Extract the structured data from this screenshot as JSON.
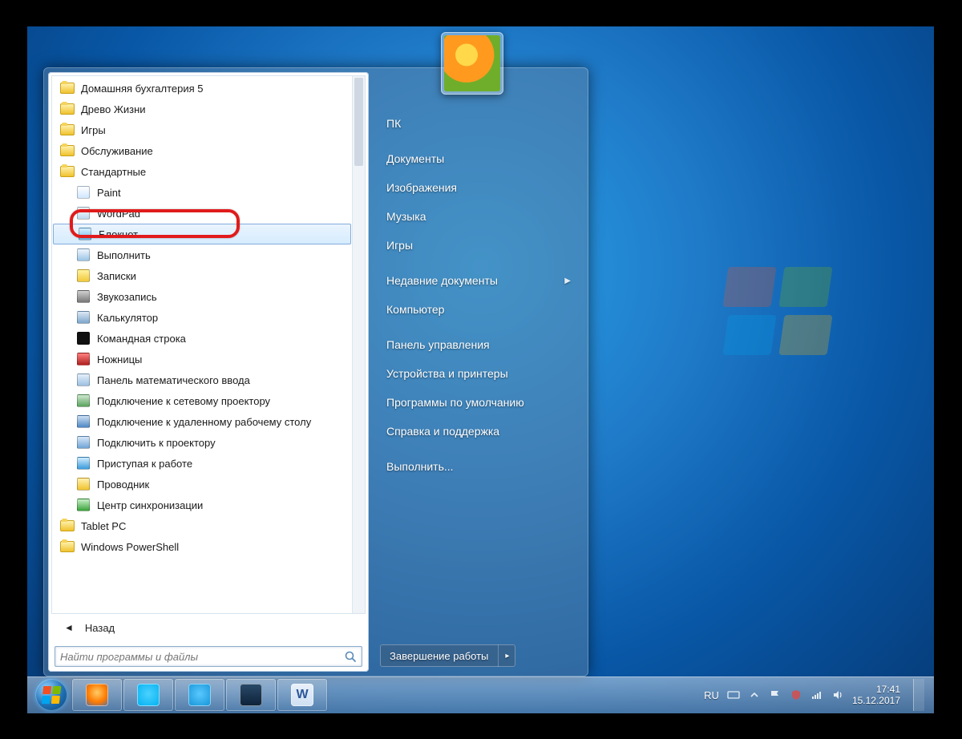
{
  "start_menu": {
    "programs": [
      {
        "label": "Домашняя бухгалтерия 5",
        "type": "folder"
      },
      {
        "label": "Древо Жизни",
        "type": "folder"
      },
      {
        "label": "Игры",
        "type": "folder"
      },
      {
        "label": "Обслуживание",
        "type": "folder"
      },
      {
        "label": "Стандартные",
        "type": "folder"
      },
      {
        "label": "Paint",
        "type": "app",
        "icon_bg": "linear-gradient(#fff,#cfe7ff)"
      },
      {
        "label": "WordPad",
        "type": "app",
        "icon_bg": "linear-gradient(#fff,#bcd8f0)"
      },
      {
        "label": "Блокнот",
        "type": "app",
        "icon_bg": "linear-gradient(#d7f0ff,#6fb8e8)",
        "highlight": true
      },
      {
        "label": "Выполнить",
        "type": "app",
        "icon_bg": "linear-gradient(#eef6ff,#9cc4e6)"
      },
      {
        "label": "Записки",
        "type": "app",
        "icon_bg": "linear-gradient(#fff3a0,#f2c83a)"
      },
      {
        "label": "Звукозапись",
        "type": "app",
        "icon_bg": "linear-gradient(#d0d0d0,#777)"
      },
      {
        "label": "Калькулятор",
        "type": "app",
        "icon_bg": "linear-gradient(#dce8f4,#7da7cc)"
      },
      {
        "label": "Командная строка",
        "type": "app",
        "icon_bg": "#111"
      },
      {
        "label": "Ножницы",
        "type": "app",
        "icon_bg": "linear-gradient(#ff8080,#b02020)"
      },
      {
        "label": "Панель математического ввода",
        "type": "app",
        "icon_bg": "linear-gradient(#e6f0fa,#9cc0e2)"
      },
      {
        "label": "Подключение к сетевому проектору",
        "type": "app",
        "icon_bg": "linear-gradient(#cfe8d0,#5aa45c)"
      },
      {
        "label": "Подключение к удаленному рабочему столу",
        "type": "app",
        "icon_bg": "linear-gradient(#cfe0f4,#4c88c4)"
      },
      {
        "label": "Подключить к проектору",
        "type": "app",
        "icon_bg": "linear-gradient(#d8e8f8,#6fa4d6)"
      },
      {
        "label": "Приступая к работе",
        "type": "app",
        "icon_bg": "linear-gradient(#d0ecff,#3a9bdc)"
      },
      {
        "label": "Проводник",
        "type": "app",
        "icon_bg": "linear-gradient(#fff2b0,#f0c22e)"
      },
      {
        "label": "Центр синхронизации",
        "type": "app",
        "icon_bg": "linear-gradient(#c8f0c8,#3aa33a)"
      },
      {
        "label": "Tablet PC",
        "type": "folder"
      },
      {
        "label": "Windows PowerShell",
        "type": "folder"
      }
    ],
    "back_label": "Назад",
    "search_placeholder": "Найти программы и файлы",
    "right_items": [
      "ПК",
      "Документы",
      "Изображения",
      "Музыка",
      "Игры",
      "Недавние документы",
      "Компьютер",
      "Панель управления",
      "Устройства и принтеры",
      "Программы по умолчанию",
      "Справка и поддержка",
      "Выполнить..."
    ],
    "right_submenu_index": 5,
    "shutdown_label": "Завершение работы"
  },
  "taskbar": {
    "apps": [
      {
        "name": "firefox",
        "bg": "radial-gradient(circle at 50% 40%,#ffcc66,#ff7a00 55%,#4a6fb0 100%)"
      },
      {
        "name": "skype",
        "bg": "radial-gradient(circle at 50% 45%,#4ad2ff,#00aff0)"
      },
      {
        "name": "telegram",
        "bg": "radial-gradient(circle at 50% 45%,#5ac8ff,#1393d6)"
      },
      {
        "name": "task-manager",
        "bg": "linear-gradient(#2a4a6a,#0d2238)"
      },
      {
        "name": "word",
        "bg": "linear-gradient(#e8f0fa,#cfe0f2)"
      }
    ],
    "word_glyph": "W",
    "lang": "RU",
    "clock_time": "17:41",
    "clock_date": "15.12.2017"
  }
}
